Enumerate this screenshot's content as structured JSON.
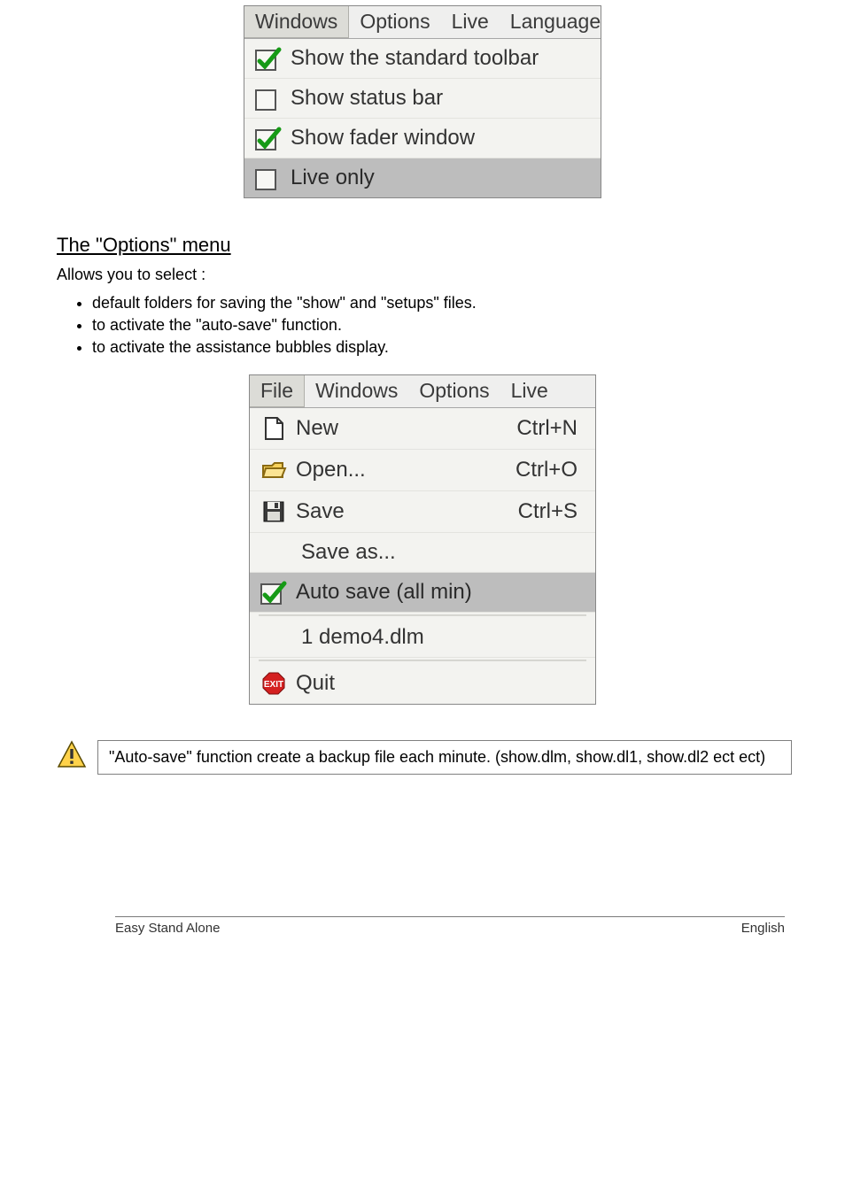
{
  "windows_menu": {
    "menubar": [
      "Windows",
      "Options",
      "Live",
      "Language"
    ],
    "active_index": 0,
    "items": [
      {
        "checked": true,
        "label": "Show the standard toolbar",
        "highlight": false
      },
      {
        "checked": false,
        "label": "Show status bar",
        "highlight": false
      },
      {
        "checked": true,
        "label": "Show fader window",
        "highlight": false
      },
      {
        "checked": false,
        "label": "Live only",
        "highlight": true
      }
    ]
  },
  "options_section": {
    "title": "The \"Options\" menu",
    "intro": "Allows you to select :",
    "bullets": [
      "default folders for saving the \"show\" and \"setups\" files.",
      "to activate the \"auto-save\" function.",
      "to activate the assistance bubbles display."
    ]
  },
  "file_menu": {
    "menubar": [
      "File",
      "Windows",
      "Options",
      "Live"
    ],
    "active_index": 0,
    "items": [
      {
        "icon": "new",
        "label": "New",
        "shortcut": "Ctrl+N"
      },
      {
        "icon": "open",
        "label": "Open...",
        "shortcut": "Ctrl+O"
      },
      {
        "icon": "save",
        "label": "Save",
        "shortcut": "Ctrl+S"
      },
      {
        "icon": null,
        "label": "Save as...",
        "shortcut": ""
      },
      {
        "icon": "check",
        "label": "Auto save (all min)",
        "highlight": true
      },
      {
        "sep": true
      },
      {
        "icon": null,
        "label": "1 demo4.dlm",
        "indent": true
      },
      {
        "sep": true
      },
      {
        "icon": "exit",
        "label": "Quit"
      }
    ]
  },
  "notice": "\"Auto-save\" function create a backup file each minute. (show.dlm, show.dl1, show.dl2 ect ect)",
  "footer": {
    "left": "Easy Stand Alone",
    "right": "English"
  }
}
